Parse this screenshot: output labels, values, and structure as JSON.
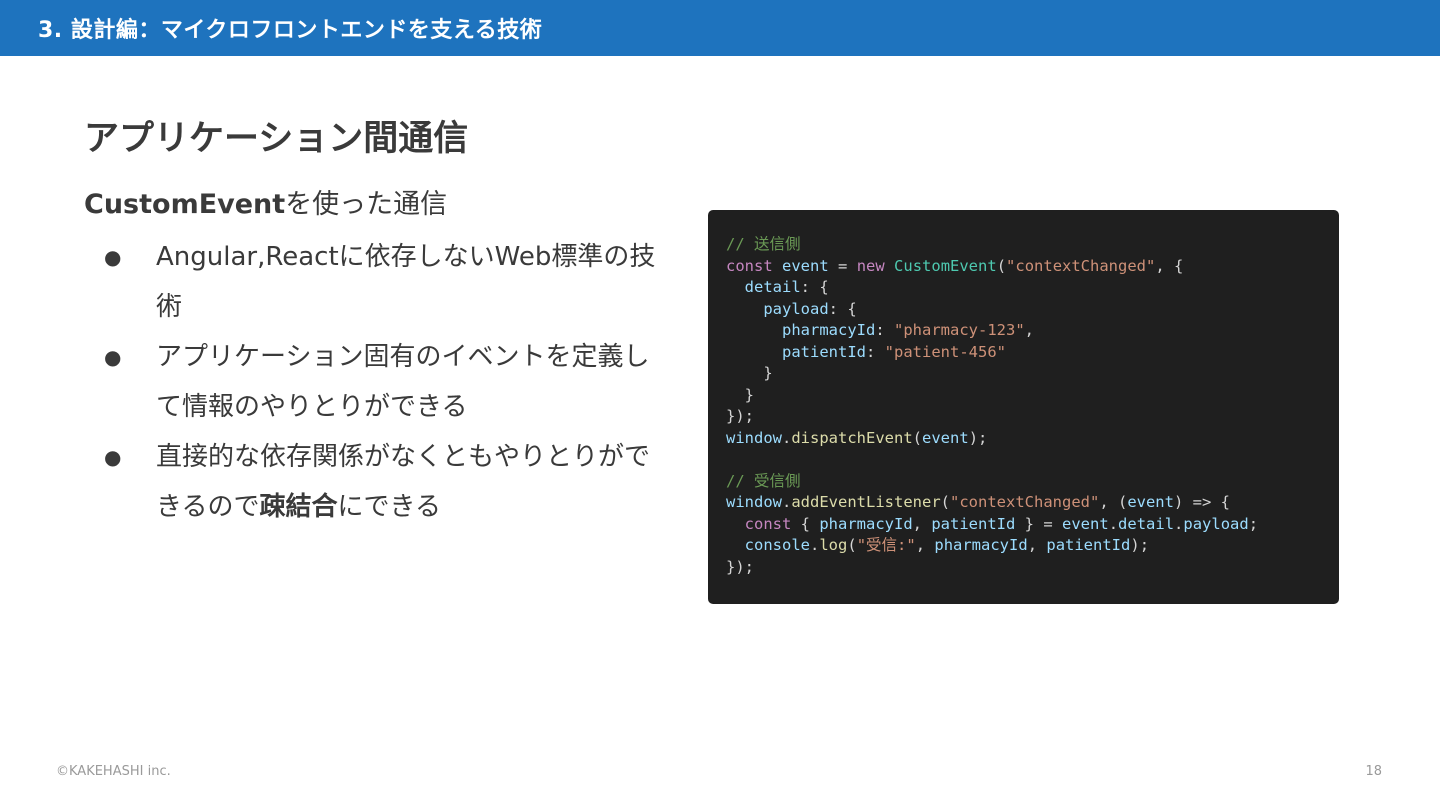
{
  "header": {
    "title": "3. 設計編：マイクロフロントエンドを支える技術"
  },
  "slide": {
    "title": "アプリケーション間通信",
    "subtitle_strong": "CustomEvent",
    "subtitle_rest": "を使った通信",
    "bullet_symbol": "●",
    "bullets": {
      "b1": "Angular,Reactに依存しないWeb標準の技術",
      "b2": "アプリケーション固有のイベントを定義して情報のやりとりができる",
      "b3_pre": "直接的な依存関係がなくともやりとりができるので",
      "b3_strong": "疎結合",
      "b3_post": "にできる"
    }
  },
  "code": {
    "lines": [
      [
        [
          "c",
          "// 送信側"
        ]
      ],
      [
        [
          "k",
          "const"
        ],
        [
          "p",
          " "
        ],
        [
          "v",
          "event"
        ],
        [
          "p",
          " = "
        ],
        [
          "k",
          "new"
        ],
        [
          "p",
          " "
        ],
        [
          "t",
          "CustomEvent"
        ],
        [
          "p",
          "("
        ],
        [
          "s",
          "\"contextChanged\""
        ],
        [
          "p",
          ", {"
        ]
      ],
      [
        [
          "p",
          "  "
        ],
        [
          "v",
          "detail"
        ],
        [
          "p",
          ": {"
        ]
      ],
      [
        [
          "p",
          "    "
        ],
        [
          "v",
          "payload"
        ],
        [
          "p",
          ": {"
        ]
      ],
      [
        [
          "p",
          "      "
        ],
        [
          "v",
          "pharmacyId"
        ],
        [
          "p",
          ": "
        ],
        [
          "s",
          "\"pharmacy-123\""
        ],
        [
          "p",
          ","
        ]
      ],
      [
        [
          "p",
          "      "
        ],
        [
          "v",
          "patientId"
        ],
        [
          "p",
          ": "
        ],
        [
          "s",
          "\"patient-456\""
        ]
      ],
      [
        [
          "p",
          "    }"
        ]
      ],
      [
        [
          "p",
          "  }"
        ]
      ],
      [
        [
          "p",
          "});"
        ]
      ],
      [
        [
          "v",
          "window"
        ],
        [
          "p",
          "."
        ],
        [
          "f",
          "dispatchEvent"
        ],
        [
          "p",
          "("
        ],
        [
          "v",
          "event"
        ],
        [
          "p",
          ");"
        ]
      ],
      [
        [
          "p",
          ""
        ]
      ],
      [
        [
          "c",
          "// 受信側"
        ]
      ],
      [
        [
          "v",
          "window"
        ],
        [
          "p",
          "."
        ],
        [
          "f",
          "addEventListener"
        ],
        [
          "p",
          "("
        ],
        [
          "s",
          "\"contextChanged\""
        ],
        [
          "p",
          ", ("
        ],
        [
          "v",
          "event"
        ],
        [
          "p",
          ") => {"
        ]
      ],
      [
        [
          "p",
          "  "
        ],
        [
          "k",
          "const"
        ],
        [
          "p",
          " { "
        ],
        [
          "v",
          "pharmacyId"
        ],
        [
          "p",
          ", "
        ],
        [
          "v",
          "patientId"
        ],
        [
          "p",
          " } = "
        ],
        [
          "v",
          "event"
        ],
        [
          "p",
          "."
        ],
        [
          "v",
          "detail"
        ],
        [
          "p",
          "."
        ],
        [
          "v",
          "payload"
        ],
        [
          "p",
          ";"
        ]
      ],
      [
        [
          "p",
          "  "
        ],
        [
          "v",
          "console"
        ],
        [
          "p",
          "."
        ],
        [
          "f",
          "log"
        ],
        [
          "p",
          "("
        ],
        [
          "s",
          "\"受信:\""
        ],
        [
          "p",
          ", "
        ],
        [
          "v",
          "pharmacyId"
        ],
        [
          "p",
          ", "
        ],
        [
          "v",
          "patientId"
        ],
        [
          "p",
          ");"
        ]
      ],
      [
        [
          "p",
          "});"
        ]
      ]
    ]
  },
  "footer": {
    "copyright": "©KAKEHASHI inc.",
    "page_number": "18"
  }
}
